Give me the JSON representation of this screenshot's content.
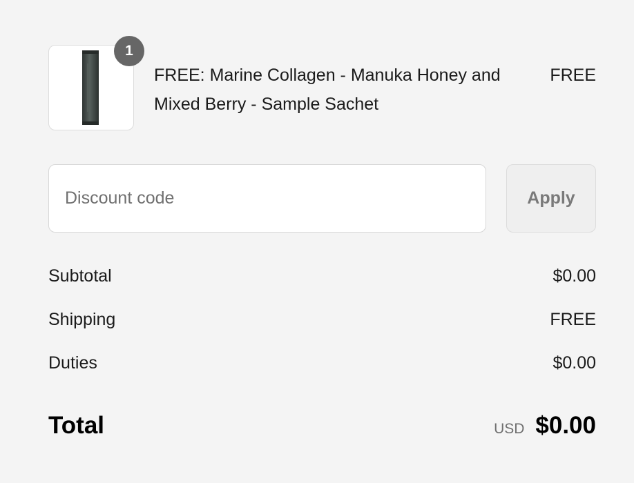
{
  "line_item": {
    "quantity": "1",
    "name": "FREE: Marine Collagen - Manuka Honey and Mixed Berry - Sample Sachet",
    "price": "FREE",
    "image_icon": "sachet-product-image"
  },
  "discount": {
    "placeholder": "Discount code",
    "value": "",
    "apply_label": "Apply"
  },
  "summary": {
    "subtotal_label": "Subtotal",
    "subtotal_value": "$0.00",
    "shipping_label": "Shipping",
    "shipping_value": "FREE",
    "duties_label": "Duties",
    "duties_value": "$0.00",
    "total_label": "Total",
    "total_currency": "USD",
    "total_value": "$0.00"
  },
  "colors": {
    "page_background": "#f4f4f4",
    "badge": "#666666",
    "apply_text": "#7a7a7a"
  }
}
